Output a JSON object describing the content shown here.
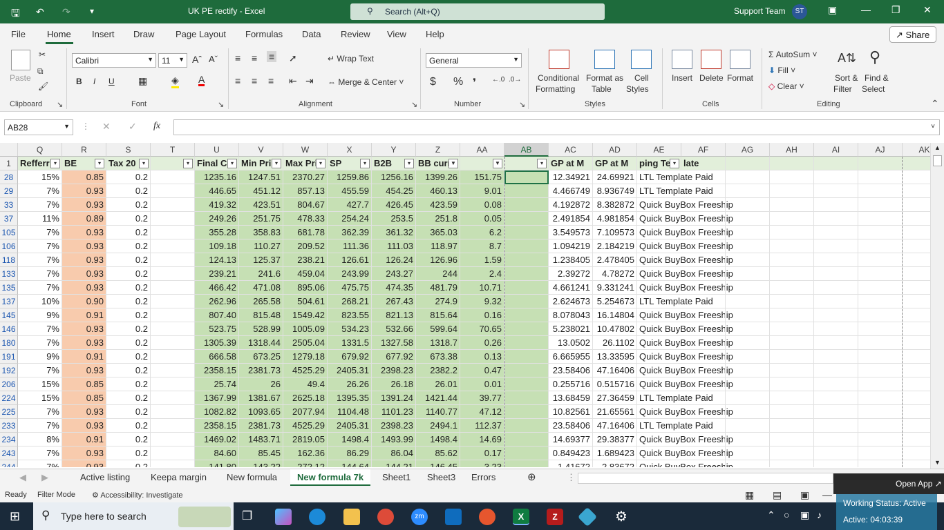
{
  "window": {
    "title": "UK PE rectify  -  Excel",
    "search": "Search (Alt+Q)",
    "user": "Support Team",
    "initials": "ST"
  },
  "menu": [
    "File",
    "Home",
    "Insert",
    "Draw",
    "Page Layout",
    "Formulas",
    "Data",
    "Review",
    "View",
    "Help"
  ],
  "share": "Share",
  "ribbon": {
    "clipboard": {
      "paste": "Paste",
      "label": "Clipboard"
    },
    "font": {
      "name": "Calibri",
      "size": "11",
      "label": "Font"
    },
    "alignment": {
      "wrap": "Wrap Text",
      "merge": "Merge & Center",
      "label": "Alignment"
    },
    "number": {
      "format": "General",
      "label": "Number"
    },
    "styles": {
      "cond1": "Conditional",
      "cond2": "Formatting",
      "fmt1": "Format as",
      "fmt2": "Table",
      "cell1": "Cell",
      "cell2": "Styles",
      "label": "Styles"
    },
    "cells": {
      "insert": "Insert",
      "delete": "Delete",
      "format": "Format",
      "label": "Cells"
    },
    "editing": {
      "autosum": "AutoSum",
      "fill": "Fill",
      "clear": "Clear",
      "sort1": "Sort &",
      "sort2": "Filter",
      "find1": "Find &",
      "find2": "Select",
      "label": "Editing"
    }
  },
  "namebox": "AB28",
  "columns": [
    "Q",
    "R",
    "S",
    "T",
    "U",
    "V",
    "W",
    "X",
    "Y",
    "Z",
    "AA",
    "AB",
    "AC",
    "AD",
    "AE",
    "AF",
    "AG",
    "AH",
    "AI",
    "AJ",
    "AK"
  ],
  "headers": [
    "Refferr",
    "BE",
    "Tax 20",
    "",
    "Final Co",
    "Min Pri",
    "Max Pri",
    "SP",
    "B2B",
    "BB curr",
    "",
    "",
    "GP at M",
    "GP at M",
    "ping Te",
    "late"
  ],
  "rows": [
    {
      "n": "28",
      "v": [
        "15%",
        "0.85",
        "0.2",
        "",
        "1235.16",
        "1247.51",
        "2370.27",
        "1259.86",
        "1256.16",
        "1399.26",
        "151.75",
        "",
        "12.34921",
        "24.69921",
        "LTL Template Paid"
      ]
    },
    {
      "n": "29",
      "v": [
        "7%",
        "0.93",
        "0.2",
        "",
        "446.65",
        "451.12",
        "857.13",
        "455.59",
        "454.25",
        "460.13",
        "9.01",
        "",
        "4.466749",
        "8.936749",
        "LTL Template Paid"
      ]
    },
    {
      "n": "33",
      "v": [
        "7%",
        "0.93",
        "0.2",
        "",
        "419.32",
        "423.51",
        "804.67",
        "427.7",
        "426.45",
        "423.59",
        "0.08",
        "",
        "4.192872",
        "8.382872",
        "Quick BuyBox Freeship"
      ]
    },
    {
      "n": "37",
      "v": [
        "11%",
        "0.89",
        "0.2",
        "",
        "249.26",
        "251.75",
        "478.33",
        "254.24",
        "253.5",
        "251.8",
        "0.05",
        "",
        "2.491854",
        "4.981854",
        "Quick BuyBox Freeship"
      ]
    },
    {
      "n": "105",
      "v": [
        "7%",
        "0.93",
        "0.2",
        "",
        "355.28",
        "358.83",
        "681.78",
        "362.39",
        "361.32",
        "365.03",
        "6.2",
        "",
        "3.549573",
        "7.109573",
        "Quick BuyBox Freeship"
      ]
    },
    {
      "n": "106",
      "v": [
        "7%",
        "0.93",
        "0.2",
        "",
        "109.18",
        "110.27",
        "209.52",
        "111.36",
        "111.03",
        "118.97",
        "8.7",
        "",
        "1.094219",
        "2.184219",
        "Quick BuyBox Freeship"
      ]
    },
    {
      "n": "118",
      "v": [
        "7%",
        "0.93",
        "0.2",
        "",
        "124.13",
        "125.37",
        "238.21",
        "126.61",
        "126.24",
        "126.96",
        "1.59",
        "",
        "1.238405",
        "2.478405",
        "Quick BuyBox Freeship"
      ]
    },
    {
      "n": "133",
      "v": [
        "7%",
        "0.93",
        "0.2",
        "",
        "239.21",
        "241.6",
        "459.04",
        "243.99",
        "243.27",
        "244",
        "2.4",
        "",
        "2.39272",
        "4.78272",
        "Quick BuyBox Freeship"
      ]
    },
    {
      "n": "135",
      "v": [
        "7%",
        "0.93",
        "0.2",
        "",
        "466.42",
        "471.08",
        "895.06",
        "475.75",
        "474.35",
        "481.79",
        "10.71",
        "",
        "4.661241",
        "9.331241",
        "Quick BuyBox Freeship"
      ]
    },
    {
      "n": "137",
      "v": [
        "10%",
        "0.90",
        "0.2",
        "",
        "262.96",
        "265.58",
        "504.61",
        "268.21",
        "267.43",
        "274.9",
        "9.32",
        "",
        "2.624673",
        "5.254673",
        "LTL Template Paid"
      ]
    },
    {
      "n": "145",
      "v": [
        "9%",
        "0.91",
        "0.2",
        "",
        "807.40",
        "815.48",
        "1549.42",
        "823.55",
        "821.13",
        "815.64",
        "0.16",
        "",
        "8.078043",
        "16.14804",
        "Quick BuyBox Freeship"
      ]
    },
    {
      "n": "146",
      "v": [
        "7%",
        "0.93",
        "0.2",
        "",
        "523.75",
        "528.99",
        "1005.09",
        "534.23",
        "532.66",
        "599.64",
        "70.65",
        "",
        "5.238021",
        "10.47802",
        "Quick BuyBox Freeship"
      ]
    },
    {
      "n": "180",
      "v": [
        "7%",
        "0.93",
        "0.2",
        "",
        "1305.39",
        "1318.44",
        "2505.04",
        "1331.5",
        "1327.58",
        "1318.7",
        "0.26",
        "",
        "13.0502",
        "26.1102",
        "Quick BuyBox Freeship"
      ]
    },
    {
      "n": "191",
      "v": [
        "9%",
        "0.91",
        "0.2",
        "",
        "666.58",
        "673.25",
        "1279.18",
        "679.92",
        "677.92",
        "673.38",
        "0.13",
        "",
        "6.665955",
        "13.33595",
        "Quick BuyBox Freeship"
      ]
    },
    {
      "n": "192",
      "v": [
        "7%",
        "0.93",
        "0.2",
        "",
        "2358.15",
        "2381.73",
        "4525.29",
        "2405.31",
        "2398.23",
        "2382.2",
        "0.47",
        "",
        "23.58406",
        "47.16406",
        "Quick BuyBox Freeship"
      ]
    },
    {
      "n": "206",
      "v": [
        "15%",
        "0.85",
        "0.2",
        "",
        "25.74",
        "26",
        "49.4",
        "26.26",
        "26.18",
        "26.01",
        "0.01",
        "",
        "0.255716",
        "0.515716",
        "Quick BuyBox Freeship"
      ]
    },
    {
      "n": "224",
      "v": [
        "15%",
        "0.85",
        "0.2",
        "",
        "1367.99",
        "1381.67",
        "2625.18",
        "1395.35",
        "1391.24",
        "1421.44",
        "39.77",
        "",
        "13.68459",
        "27.36459",
        "LTL Template Paid"
      ]
    },
    {
      "n": "225",
      "v": [
        "7%",
        "0.93",
        "0.2",
        "",
        "1082.82",
        "1093.65",
        "2077.94",
        "1104.48",
        "1101.23",
        "1140.77",
        "47.12",
        "",
        "10.82561",
        "21.65561",
        "Quick BuyBox Freeship"
      ]
    },
    {
      "n": "233",
      "v": [
        "7%",
        "0.93",
        "0.2",
        "",
        "2358.15",
        "2381.73",
        "4525.29",
        "2405.31",
        "2398.23",
        "2494.1",
        "112.37",
        "",
        "23.58406",
        "47.16406",
        "LTL Template Paid"
      ]
    },
    {
      "n": "234",
      "v": [
        "8%",
        "0.91",
        "0.2",
        "",
        "1469.02",
        "1483.71",
        "2819.05",
        "1498.4",
        "1493.99",
        "1498.4",
        "14.69",
        "",
        "14.69377",
        "29.38377",
        "Quick BuyBox Freeship"
      ]
    },
    {
      "n": "243",
      "v": [
        "7%",
        "0.93",
        "0.2",
        "",
        "84.60",
        "85.45",
        "162.36",
        "86.29",
        "86.04",
        "85.62",
        "0.17",
        "",
        "0.849423",
        "1.689423",
        "Quick BuyBox Freeship"
      ]
    },
    {
      "n": "244",
      "v": [
        "7%",
        "0.93",
        "0.2",
        "",
        "141.80",
        "143.22",
        "272.12",
        "144.64",
        "144.21",
        "146.45",
        "3.23",
        "",
        "1.41672",
        "2.83672",
        "Quick BuyBox Freeship"
      ]
    }
  ],
  "sheets": [
    "Active listing",
    "Keepa margin",
    "New formula",
    "New formula 7k",
    "Sheet1",
    "Sheet3",
    "Errors"
  ],
  "status": {
    "ready": "Ready",
    "filter": "Filter Mode",
    "access": "Accessibility: Investigate"
  },
  "taskbar": {
    "search": "Type here to search"
  },
  "overlay": {
    "open_app": "Open App",
    "working": "Working Status: Active",
    "active": "Active: 04:03:39"
  },
  "colors": {
    "excel_green": "#1e6b3c",
    "green_fill": "#c6e0b4",
    "orange_fill": "#f8cbad"
  }
}
